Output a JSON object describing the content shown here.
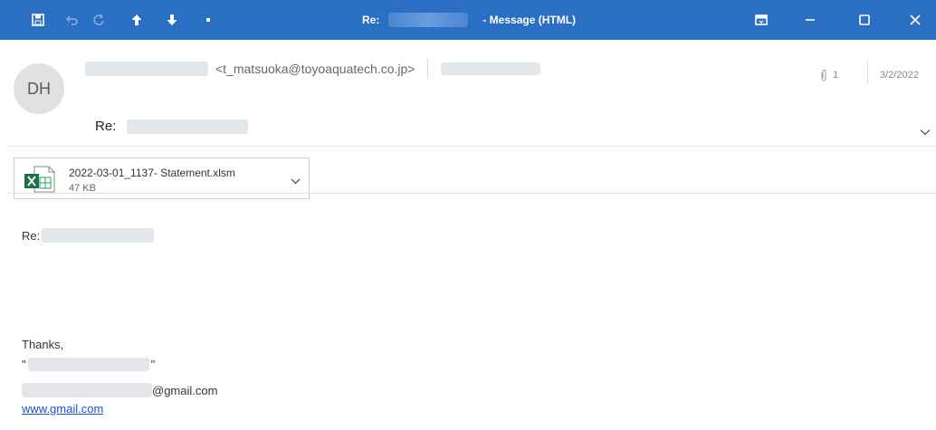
{
  "window": {
    "title_prefix": "Re:",
    "title_suffix": "- Message (HTML)"
  },
  "header": {
    "avatar_initials": "DH",
    "sender_email": "<t_matsuoka@toyoaquatech.co.jp>",
    "subject_prefix": "Re:",
    "attachment_count": "1",
    "date": "3/2/2022"
  },
  "attachment": {
    "filename": "2022-03-01_1137- Statement.xlsm",
    "size": "47 KB"
  },
  "body": {
    "greeting": "Re:",
    "closing": "Thanks,",
    "quote_open": "\"",
    "quote_close": "\"",
    "email_suffix": "@gmail.com",
    "link": "www.gmail.com"
  },
  "colors": {
    "titlebar": "#2b6fc2",
    "link": "#1a4fd1"
  },
  "icons": [
    "save-icon",
    "undo-icon",
    "redo-icon",
    "up-arrow-icon",
    "down-arrow-icon",
    "customize-menu-icon",
    "ribbon-display-icon",
    "minimize-icon",
    "maximize-icon",
    "close-icon",
    "paperclip-icon",
    "chevron-down-icon",
    "excel-file-icon"
  ]
}
